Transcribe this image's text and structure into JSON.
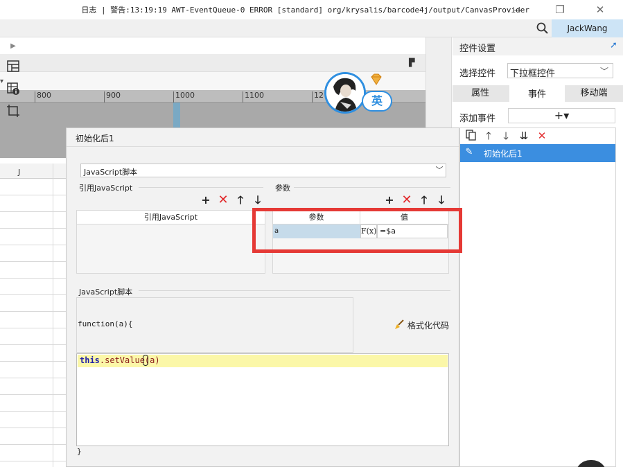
{
  "window": {
    "minimize_icon": "minimize-icon",
    "restore_icon": "restore-icon",
    "close_icon": "close-icon"
  },
  "logbar": {
    "text": "日志 | 警告:13:19:19 AWT-EventQueue-0 ERROR [standard] org/krysalis/barcode4j/output/CanvasProvider",
    "search_icon": "search-icon",
    "user": "JackWang"
  },
  "ruler": {
    "ticks": [
      "800",
      "900",
      "1000",
      "1100",
      "12"
    ]
  },
  "sheet": {
    "column_label": "J"
  },
  "right_panel": {
    "title": "控件设置",
    "select_label": "选择控件",
    "select_value": "下拉框控件",
    "tabs": [
      "属性",
      "事件",
      "移动端"
    ],
    "active_tab": "事件",
    "add_event_label": "添加事件",
    "add_event_button": "+▾",
    "event_items": [
      "初始化后1"
    ]
  },
  "avatar": {
    "badge": "英"
  },
  "dialog": {
    "title": "初始化后1",
    "type_select": "JavaScript脚本",
    "ref_section": "引用JavaScript",
    "ref_column": "引用JavaScript",
    "param_section": "参数",
    "param_columns": [
      "参数",
      "值"
    ],
    "params": [
      {
        "name": "a",
        "fx": "F(x)",
        "value": "=$a"
      }
    ],
    "script_section": "JavaScript脚本",
    "function_signature": "function(a){",
    "format_button": "格式化代码",
    "code_keyword": "this",
    "code_rest": ".setValue(a)",
    "function_close": "}"
  },
  "colors": {
    "accent": "#3b8ee0",
    "highlight_border": "#e53935",
    "delete_red": "#e2282a",
    "code_line_bg": "#fbf7a8",
    "keyword": "#1f1fa8",
    "code_text": "#8b1a1a"
  }
}
